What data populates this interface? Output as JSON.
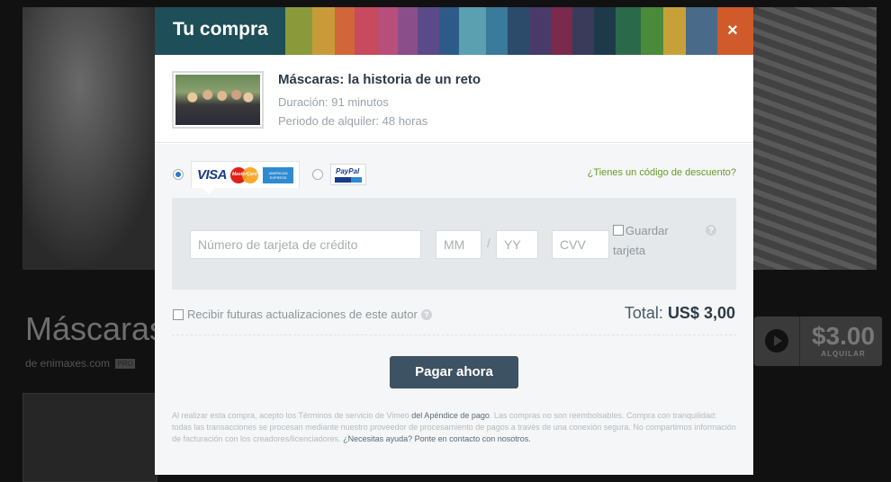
{
  "background": {
    "video_title": "Máscaras",
    "byline": "de enimaxes.com",
    "pro_badge": "PRO",
    "rent_price": "$3.00",
    "rent_label": "ALQUILAR"
  },
  "modal": {
    "title": "Tu compra",
    "close_symbol": "×",
    "product": {
      "title": "Máscaras: la historia de un reto",
      "duration": "Duración: 91 minutos",
      "rental_period": "Periodo de alquiler: 48 horas"
    },
    "payment": {
      "card_brands": {
        "visa": "VISA",
        "mastercard": "MasterCard",
        "amex": "AMERICAN EXPRESS"
      },
      "paypal_label": "PayPal",
      "discount_link": "¿Tienes un código de descuento?",
      "card_number_placeholder": "Número de tarjeta de crédito",
      "month_placeholder": "MM",
      "date_separator": "/",
      "year_placeholder": "YY",
      "cvv_placeholder": "CVV",
      "save_card_label_1": "Guardar",
      "save_card_label_2": "tarjeta",
      "help_symbol": "?",
      "updates_label": "Recibir futuras actualizaciones de este autor",
      "total_label": "Total:",
      "total_value": "US$ 3,00",
      "pay_button": "Pagar ahora"
    },
    "legal": {
      "part1": "Al realizar esta compra, acepto los Términos de servicio de Vimeo ",
      "link1": "del Apéndice de pago",
      "part2": ". Las compras no son reembolsables. Compra con tranquilidad: todas las transacciones se procesan mediante nuestro proveedor de procesamiento de pagos a través de una conexión segura. No compartimos información de facturación con los creadores/licenciadores. ",
      "link2": "¿Necesitas ayuda? Ponte en contacto con nosotros."
    }
  },
  "colors": {
    "header_base": "#1e4e57",
    "pay_button": "#3d5262",
    "discount_link": "#6a9a2a",
    "radio_selected": "#2a79c7"
  },
  "icons": [
    "close-icon",
    "radio-selected",
    "radio-unselected",
    "visa-logo",
    "mastercard-logo",
    "amex-logo",
    "paypal-logo",
    "help-icon",
    "checkbox",
    "play-icon"
  ]
}
